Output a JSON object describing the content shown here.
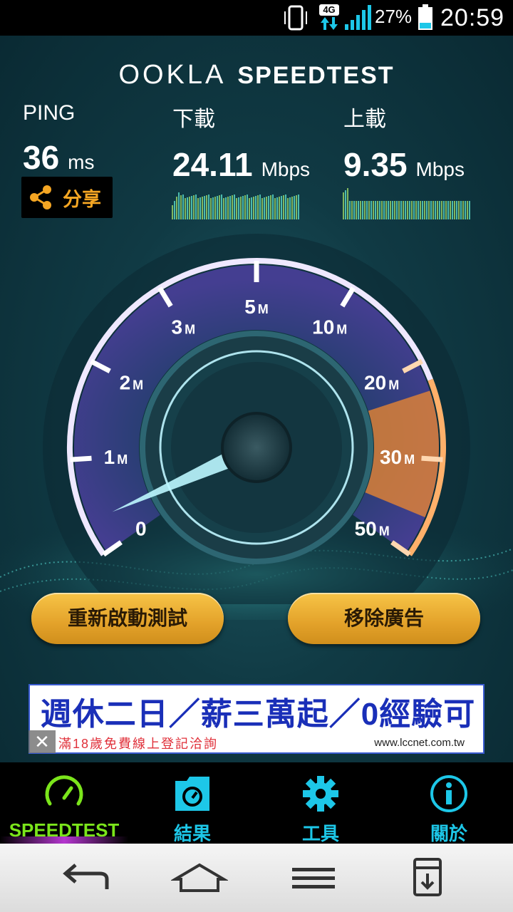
{
  "status_bar": {
    "network_type": "4G",
    "battery_percent": "27%",
    "battery_level": 0.27,
    "time": "20:59",
    "icons": [
      "phone-vibrate-icon",
      "network-4g-icon",
      "signal-strength-icon",
      "battery-icon"
    ]
  },
  "brand": {
    "logo": "OOKLA",
    "product": "SPEEDTEST"
  },
  "results": {
    "ping": {
      "label": "PING",
      "value": "36",
      "unit": "ms"
    },
    "download": {
      "label": "下載",
      "value": "24.11",
      "unit": "Mbps"
    },
    "upload": {
      "label": "上載",
      "value": "9.35",
      "unit": "Mbps"
    }
  },
  "share_button": {
    "label": "分享",
    "icon": "share-icon"
  },
  "gauge": {
    "tick_labels": [
      {
        "num": "0",
        "unit": ""
      },
      {
        "num": "1",
        "unit": "M"
      },
      {
        "num": "2",
        "unit": "M"
      },
      {
        "num": "3",
        "unit": "M"
      },
      {
        "num": "5",
        "unit": "M"
      },
      {
        "num": "10",
        "unit": "M"
      },
      {
        "num": "20",
        "unit": "M"
      },
      {
        "num": "30",
        "unit": "M"
      },
      {
        "num": "50",
        "unit": "M"
      }
    ],
    "needle_value": "0",
    "colors": {
      "ring": "#b7a1ff",
      "hot_zone": "#f28a2e",
      "inner": "#3f3a8f"
    }
  },
  "actions": {
    "restart": "重新啟動測試",
    "remove_ads": "移除廣告"
  },
  "ad": {
    "headline": "週休二日／薪三萬起／0經驗可",
    "subtext": "滿18歲免費線上登記洽詢",
    "url": "www.lccnet.com.tw",
    "close": "✕"
  },
  "tabs": [
    {
      "label": "SPEEDTEST",
      "icon": "speedometer-icon",
      "active": true
    },
    {
      "label": "結果",
      "icon": "results-folder-icon",
      "active": false
    },
    {
      "label": "工具",
      "icon": "gear-icon",
      "active": false
    },
    {
      "label": "關於",
      "icon": "info-icon",
      "active": false
    }
  ],
  "nav": [
    "back-icon",
    "home-icon",
    "menu-icon",
    "download-icon"
  ],
  "theme": {
    "accent_cyan": "#1dc7e8",
    "accent_green": "#7be51b",
    "accent_orange": "#f5a623"
  }
}
